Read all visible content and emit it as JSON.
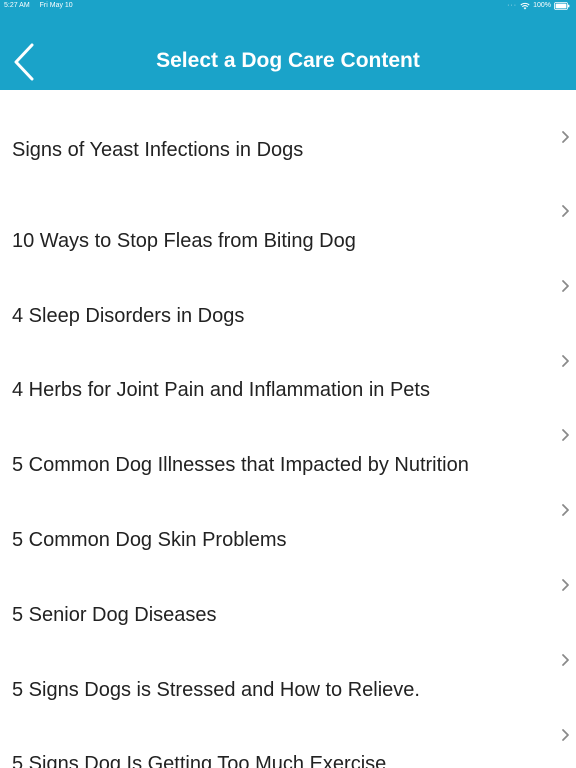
{
  "status_bar": {
    "time": "5:27 AM",
    "date": "Fri May 10",
    "battery": "100%"
  },
  "header": {
    "title": "Select a Dog Care Content",
    "back_icon": "chevron-left-icon",
    "background_color": "#1aa3c9"
  },
  "list": {
    "items": [
      {
        "label": "Signs of Yeast Infections in Dogs"
      },
      {
        "label": "10 Ways to Stop Fleas from Biting Dog"
      },
      {
        "label": "4 Sleep Disorders in Dogs"
      },
      {
        "label": "4 Herbs for Joint Pain and Inflammation in Pets"
      },
      {
        "label": "5 Common Dog Illnesses that Impacted by Nutrition"
      },
      {
        "label": "5 Common Dog Skin Problems"
      },
      {
        "label": "5 Senior Dog Diseases"
      },
      {
        "label": "5 Signs Dogs is Stressed and How to Relieve."
      },
      {
        "label": "5 Signs Dog Is Getting Too Much Exercise"
      }
    ],
    "chevron_icon": "chevron-right-icon"
  }
}
